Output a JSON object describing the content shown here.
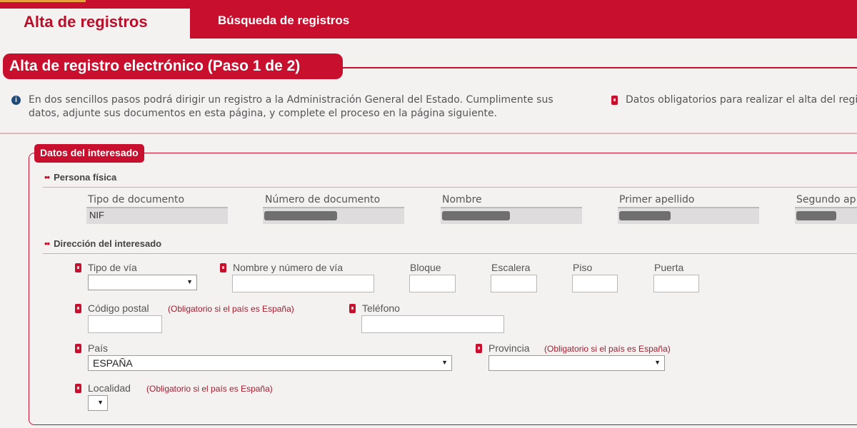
{
  "tabs": [
    {
      "label": "Alta de registros",
      "active": true
    },
    {
      "label": "Búsqueda de registros",
      "active": false
    }
  ],
  "step": {
    "title": "Alta de registro electrónico (Paso 1 de 2)"
  },
  "info": {
    "text_line1": "En dos sencillos pasos podrá dirigir un registro a la Administración General del Estado. Cumplimente sus",
    "text_line2": "datos, adjunte sus documentos en esta página, y complete el proceso en la página siguiente.",
    "required_note": "Datos obligatorios para realizar el alta del regis"
  },
  "section": {
    "title": "Datos del interesado",
    "persona": {
      "heading": "Persona física",
      "columns": [
        {
          "label": "Tipo de documento",
          "value": "NIF"
        },
        {
          "label": "Número de documento",
          "value": ""
        },
        {
          "label": "Nombre",
          "value": ""
        },
        {
          "label": "Primer apellido",
          "value": ""
        },
        {
          "label": "Segundo ap",
          "value": ""
        }
      ]
    },
    "direccion": {
      "heading": "Dirección del interesado",
      "tipo_via": {
        "label": "Tipo de vía",
        "value": ""
      },
      "nombre_via": {
        "label": "Nombre y número de vía",
        "value": ""
      },
      "bloque": {
        "label": "Bloque",
        "value": ""
      },
      "escalera": {
        "label": "Escalera",
        "value": ""
      },
      "piso": {
        "label": "Piso",
        "value": ""
      },
      "puerta": {
        "label": "Puerta",
        "value": ""
      },
      "codigo_postal": {
        "label": "Código postal",
        "note": "(Obligatorio si el país es España)",
        "value": ""
      },
      "telefono": {
        "label": "Teléfono",
        "value": ""
      },
      "pais": {
        "label": "País",
        "value": "ESPAÑA"
      },
      "provincia": {
        "label": "Provincia",
        "note": "(Obligatorio si el país es España)",
        "value": ""
      },
      "localidad": {
        "label": "Localidad",
        "note": "(Obligatorio si el país es España)",
        "value": ""
      }
    }
  },
  "colors": {
    "brand_red": "#c8102e",
    "background": "#f4f1f1",
    "info_blue": "#1f4a7a"
  },
  "icons": {
    "info": "info-circle-icon",
    "required": "required-marker-icon",
    "dropdown": "dropdown-arrow-icon"
  }
}
